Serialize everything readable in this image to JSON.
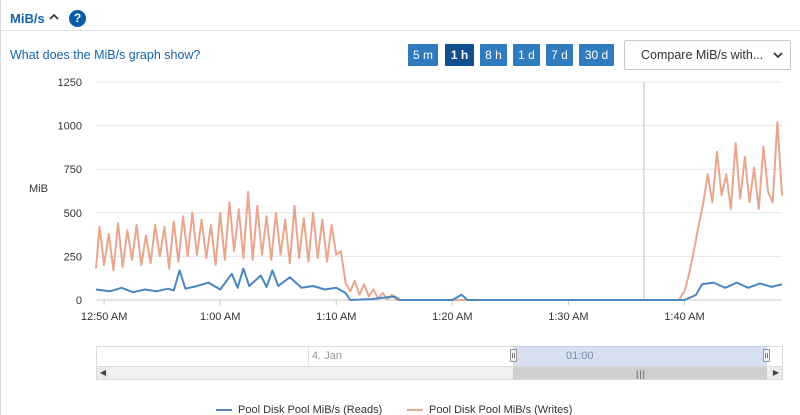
{
  "header": {
    "title": "MiB/s"
  },
  "help_link": "What does the MiB/s graph show?",
  "ranges": [
    {
      "label": "5 m",
      "active": false
    },
    {
      "label": "1 h",
      "active": true
    },
    {
      "label": "8 h",
      "active": false
    },
    {
      "label": "1 d",
      "active": false
    },
    {
      "label": "7 d",
      "active": false
    },
    {
      "label": "30 d",
      "active": false
    }
  ],
  "compare": {
    "label": "Compare MiB/s with..."
  },
  "navigator": {
    "date_label": "4. Jan",
    "time_label": "01:00"
  },
  "colors": {
    "reads": "#4a86bf",
    "writes": "#e8a78d",
    "accent": "#2e7bbd"
  },
  "chart_data": {
    "type": "line",
    "ylabel": "MiB",
    "ylim": [
      0,
      1250
    ],
    "yticks": [
      "0",
      "250",
      "500",
      "750",
      "1000",
      "1250"
    ],
    "xticks": [
      "12:50 AM",
      "1:00 AM",
      "1:10 AM",
      "1:20 AM",
      "1:30 AM",
      "1:40 AM"
    ],
    "xlim_minutes": [
      49.3,
      108.4
    ],
    "crosshair_minutes": 96.5,
    "series": [
      {
        "name": "Pool Disk  Pool MiB/s (Reads)",
        "color": "#4a86bf",
        "points": [
          [
            49.3,
            60
          ],
          [
            50.5,
            50
          ],
          [
            51.5,
            70
          ],
          [
            52.5,
            45
          ],
          [
            53.5,
            60
          ],
          [
            54.5,
            50
          ],
          [
            55.5,
            65
          ],
          [
            56.0,
            55
          ],
          [
            56.5,
            170
          ],
          [
            57.0,
            65
          ],
          [
            58.0,
            80
          ],
          [
            59.0,
            100
          ],
          [
            60.0,
            60
          ],
          [
            61.0,
            150
          ],
          [
            61.5,
            70
          ],
          [
            62.0,
            180
          ],
          [
            62.5,
            80
          ],
          [
            63.5,
            140
          ],
          [
            64.0,
            75
          ],
          [
            64.5,
            170
          ],
          [
            65.0,
            80
          ],
          [
            66.0,
            130
          ],
          [
            67.0,
            70
          ],
          [
            68.0,
            80
          ],
          [
            69.0,
            60
          ],
          [
            70.0,
            70
          ],
          [
            70.8,
            40
          ],
          [
            71.2,
            0
          ],
          [
            73.0,
            5
          ],
          [
            75.0,
            20
          ],
          [
            75.5,
            0
          ],
          [
            80.0,
            0
          ],
          [
            80.8,
            30
          ],
          [
            81.3,
            0
          ],
          [
            90.0,
            0
          ],
          [
            96.0,
            0
          ],
          [
            100.0,
            0
          ],
          [
            101.0,
            30
          ],
          [
            101.5,
            90
          ],
          [
            102.5,
            100
          ],
          [
            103.5,
            70
          ],
          [
            104.5,
            100
          ],
          [
            105.5,
            70
          ],
          [
            106.5,
            95
          ],
          [
            107.5,
            75
          ],
          [
            108.4,
            90
          ]
        ]
      },
      {
        "name": "Pool Disk  Pool MiB/s (Writes)",
        "color": "#e8a78d",
        "points": [
          [
            49.3,
            180
          ],
          [
            49.6,
            420
          ],
          [
            50.0,
            200
          ],
          [
            50.4,
            380
          ],
          [
            50.8,
            170
          ],
          [
            51.2,
            440
          ],
          [
            51.6,
            190
          ],
          [
            52.0,
            400
          ],
          [
            52.4,
            230
          ],
          [
            52.8,
            430
          ],
          [
            53.2,
            200
          ],
          [
            53.6,
            370
          ],
          [
            54.0,
            210
          ],
          [
            54.4,
            430
          ],
          [
            54.8,
            250
          ],
          [
            55.2,
            420
          ],
          [
            55.6,
            180
          ],
          [
            56.0,
            450
          ],
          [
            56.4,
            220
          ],
          [
            56.8,
            480
          ],
          [
            57.2,
            250
          ],
          [
            57.6,
            500
          ],
          [
            58.0,
            260
          ],
          [
            58.4,
            460
          ],
          [
            58.8,
            240
          ],
          [
            59.2,
            430
          ],
          [
            59.6,
            200
          ],
          [
            60.0,
            500
          ],
          [
            60.4,
            230
          ],
          [
            60.8,
            560
          ],
          [
            61.2,
            280
          ],
          [
            61.6,
            520
          ],
          [
            62.0,
            240
          ],
          [
            62.4,
            620
          ],
          [
            62.8,
            230
          ],
          [
            63.2,
            540
          ],
          [
            63.6,
            260
          ],
          [
            64.0,
            480
          ],
          [
            64.4,
            230
          ],
          [
            64.8,
            500
          ],
          [
            65.2,
            260
          ],
          [
            65.6,
            460
          ],
          [
            66.0,
            210
          ],
          [
            66.4,
            540
          ],
          [
            66.8,
            240
          ],
          [
            67.2,
            470
          ],
          [
            67.6,
            220
          ],
          [
            68.0,
            500
          ],
          [
            68.4,
            240
          ],
          [
            68.8,
            460
          ],
          [
            69.2,
            220
          ],
          [
            69.6,
            430
          ],
          [
            70.0,
            260
          ],
          [
            70.4,
            280
          ],
          [
            70.8,
            100
          ],
          [
            71.2,
            50
          ],
          [
            71.6,
            110
          ],
          [
            72.0,
            30
          ],
          [
            72.4,
            90
          ],
          [
            72.8,
            20
          ],
          [
            73.2,
            60
          ],
          [
            73.6,
            10
          ],
          [
            74.0,
            40
          ],
          [
            74.4,
            5
          ],
          [
            74.8,
            30
          ],
          [
            75.2,
            0
          ],
          [
            77.0,
            0
          ],
          [
            80.0,
            0
          ],
          [
            85.0,
            0
          ],
          [
            90.0,
            0
          ],
          [
            96.0,
            0
          ],
          [
            99.5,
            0
          ],
          [
            100.0,
            50
          ],
          [
            100.4,
            150
          ],
          [
            100.8,
            280
          ],
          [
            101.2,
            420
          ],
          [
            101.6,
            550
          ],
          [
            102.0,
            720
          ],
          [
            102.4,
            560
          ],
          [
            102.8,
            850
          ],
          [
            103.2,
            600
          ],
          [
            103.6,
            720
          ],
          [
            104.0,
            520
          ],
          [
            104.4,
            900
          ],
          [
            104.8,
            580
          ],
          [
            105.2,
            820
          ],
          [
            105.6,
            560
          ],
          [
            106.0,
            760
          ],
          [
            106.4,
            520
          ],
          [
            106.8,
            880
          ],
          [
            107.2,
            620
          ],
          [
            107.6,
            560
          ],
          [
            108.0,
            1020
          ],
          [
            108.4,
            600
          ]
        ]
      }
    ]
  },
  "legend": [
    {
      "label": "Pool Disk  Pool MiB/s (Reads)"
    },
    {
      "label": "Pool Disk  Pool MiB/s (Writes)"
    }
  ]
}
